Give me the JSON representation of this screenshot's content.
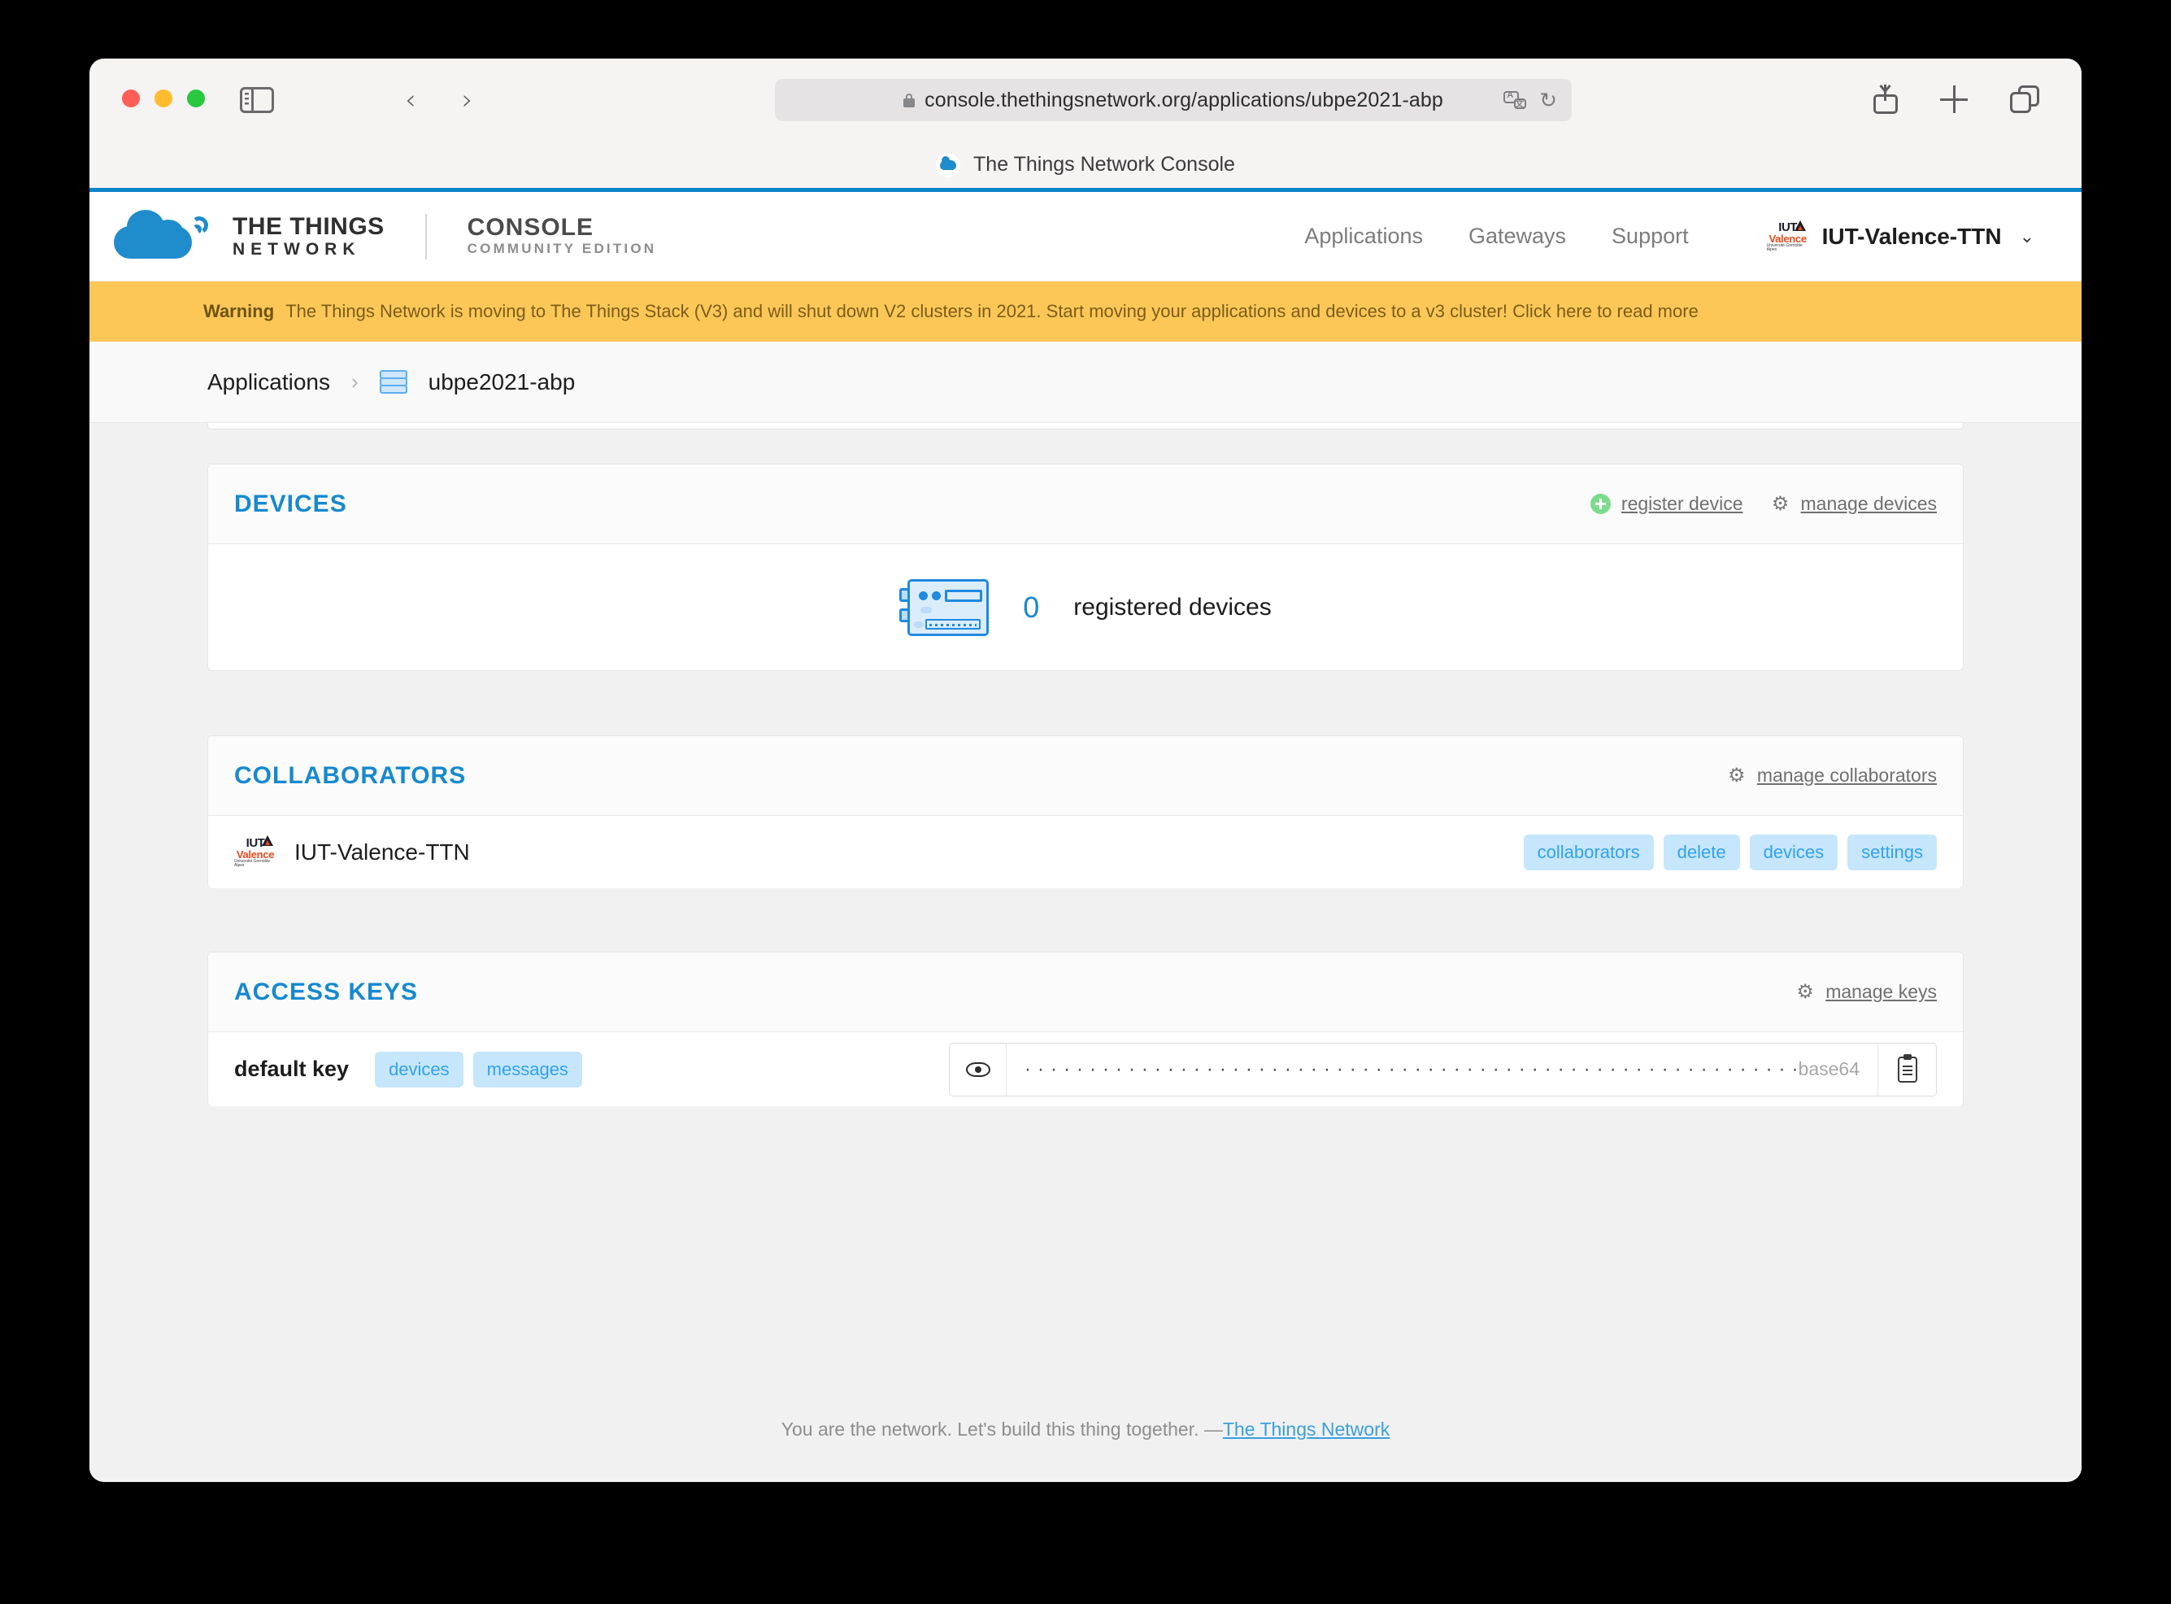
{
  "browser": {
    "url": "console.thethingsnetwork.org/applications/ubpe2021-abp",
    "tab_title": "The Things Network Console",
    "icons": {
      "lock": "lock-icon",
      "translate": "translate-icon",
      "reload": "reload-icon",
      "share": "share-icon",
      "new_tab": "plus-icon",
      "tab_overview": "tab-overview-icon",
      "sidebar": "sidebar-toggle-icon",
      "back": "‹",
      "forward": "›"
    },
    "translate_glyphs": {
      "a": "A",
      "x": "文"
    },
    "reload_glyph": "↻"
  },
  "header": {
    "brand_line1": "THE THINGS",
    "brand_line2": "NETWORK",
    "console_line1": "CONSOLE",
    "console_line2": "COMMUNITY EDITION",
    "nav": [
      {
        "label": "Applications"
      },
      {
        "label": "Gateways"
      },
      {
        "label": "Support"
      }
    ],
    "user": {
      "name": "IUT-Valence-TTN",
      "avatar_top": "IUT",
      "avatar_bottom": "Valence",
      "avatar_sub": "Université Grenoble Alpes",
      "chevron": "⌄"
    }
  },
  "warning": {
    "label": "Warning",
    "text": "The Things Network is moving to The Things Stack (V3) and will shut down V2 clusters in 2021. Start moving your applications and devices to a v3 cluster! Click here to read more"
  },
  "breadcrumb": {
    "root": "Applications",
    "separator": "›",
    "current": "ubpe2021-abp"
  },
  "devices": {
    "title": "DEVICES",
    "register_label": "register device",
    "manage_label": "manage devices",
    "count": "0",
    "count_label": "registered devices",
    "gear_glyph": "⚙"
  },
  "collaborators": {
    "title": "COLLABORATORS",
    "manage_label": "manage collaborators",
    "gear_glyph": "⚙",
    "rows": [
      {
        "name": "IUT-Valence-TTN",
        "tags": [
          "collaborators",
          "delete",
          "devices",
          "settings"
        ]
      }
    ]
  },
  "access_keys": {
    "title": "ACCESS KEYS",
    "manage_label": "manage keys",
    "gear_glyph": "⚙",
    "rows": [
      {
        "name": "default key",
        "tags": [
          "devices",
          "messages"
        ],
        "masked_value": "····································································",
        "encoding": "base64"
      }
    ]
  },
  "footer": {
    "text": "You are the network. Let's build this thing together. — ",
    "link": "The Things Network"
  },
  "colors": {
    "accent_blue": "#1689cf",
    "warning_bg": "#fdc758",
    "tag_bg": "#c6e6fb",
    "tag_text": "#32a2ef",
    "plus_green": "#7ddb8d"
  }
}
